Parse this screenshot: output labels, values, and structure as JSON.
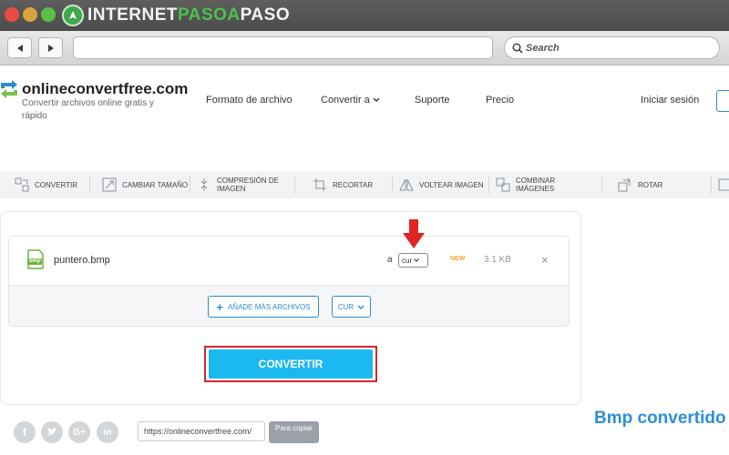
{
  "browser": {
    "brand_prefix": "INTERNET",
    "brand_middle": "PASOA",
    "brand_suffix": "PASO",
    "search_placeholder": "Search"
  },
  "site": {
    "name": "onlineconvertfree.com",
    "tagline": "Convertir archivos online gratis y rápido",
    "nav": {
      "formato": "Formato de archivo",
      "convertir": "Convertir a",
      "soporte": "Suporte",
      "precio": "Precio",
      "login": "Iniciar sesión"
    }
  },
  "tools": [
    {
      "label": "CONVERTIR",
      "icon": "convert-icon"
    },
    {
      "label": "CAMBIAR TAMAÑO",
      "icon": "resize-icon"
    },
    {
      "label": "COMPRESIÓN DE IMAGEN",
      "icon": "compress-icon"
    },
    {
      "label": "RECORTAR",
      "icon": "crop-icon"
    },
    {
      "label": "VOLTEAR IMAGEN",
      "icon": "flip-icon"
    },
    {
      "label": "COMBINAR IMÁGENES",
      "icon": "combine-icon"
    },
    {
      "label": "ROTAR",
      "icon": "rotate-icon"
    }
  ],
  "file": {
    "icon_label": "bmp",
    "name": "puntero.bmp",
    "to": "a",
    "format": "cur",
    "badge": "NEW",
    "size": "3.1 KB",
    "remove": "×"
  },
  "actions": {
    "add_more": "AÑADE MÁS ARCHIVOS",
    "format_all": "CUR",
    "convert": "CONVERTIR"
  },
  "share": {
    "url": "https://onlineconvertfree.com/",
    "copy": "Para copiar"
  },
  "section_title": "Bmp convertido",
  "colors": {
    "accent": "#1cb8f0",
    "link": "#2d8ccd",
    "highlight": "#d8262d",
    "new_badge": "#f0a92a"
  }
}
